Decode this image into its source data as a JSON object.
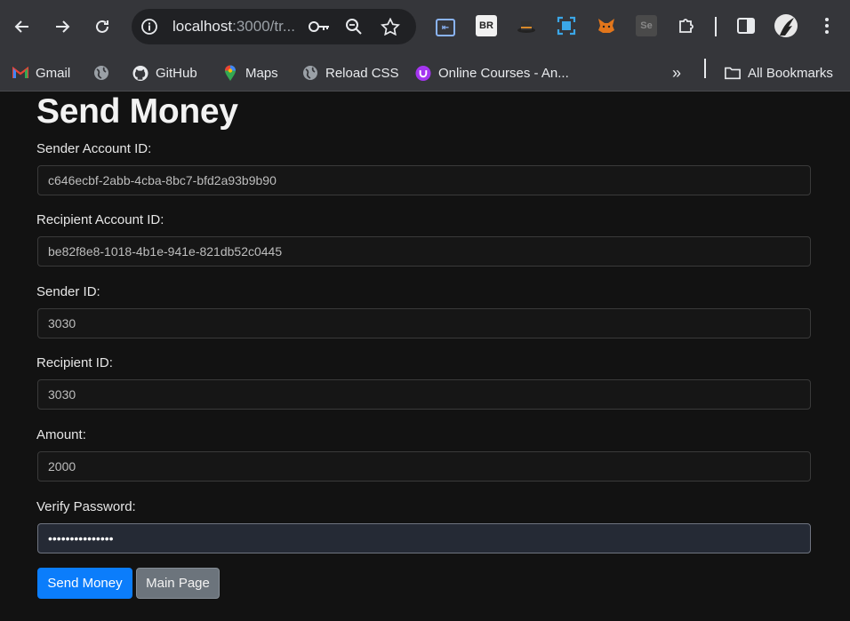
{
  "browser": {
    "url_host": "localhost",
    "url_rest": ":3000/tr...",
    "bookmarks": [
      {
        "label": "Gmail"
      },
      {
        "label": ""
      },
      {
        "label": "GitHub"
      },
      {
        "label": "Maps"
      },
      {
        "label": "Reload CSS"
      },
      {
        "label": "Online Courses - An..."
      }
    ],
    "all_bookmarks_label": "All Bookmarks",
    "overflow_label": "»",
    "extensions": [
      "BR",
      "Se"
    ]
  },
  "form": {
    "title": "Send Money",
    "fields": [
      {
        "label": "Sender Account ID:",
        "value": "c646ecbf-2abb-4cba-8bc7-bfd2a93b9b90"
      },
      {
        "label": "Recipient Account ID:",
        "value": "be82f8e8-1018-4b1e-941e-821db52c0445"
      },
      {
        "label": "Sender ID:",
        "value": "3030"
      },
      {
        "label": "Recipient ID:",
        "value": "3030"
      },
      {
        "label": "Amount:",
        "value": "2000"
      },
      {
        "label": "Verify Password:",
        "value": "•••••••••••••••"
      }
    ],
    "submit_label": "Send Money",
    "main_page_label": "Main Page"
  },
  "colors": {
    "primary": "#0b7dfb",
    "secondary": "#6c747c",
    "background": "#121212"
  }
}
